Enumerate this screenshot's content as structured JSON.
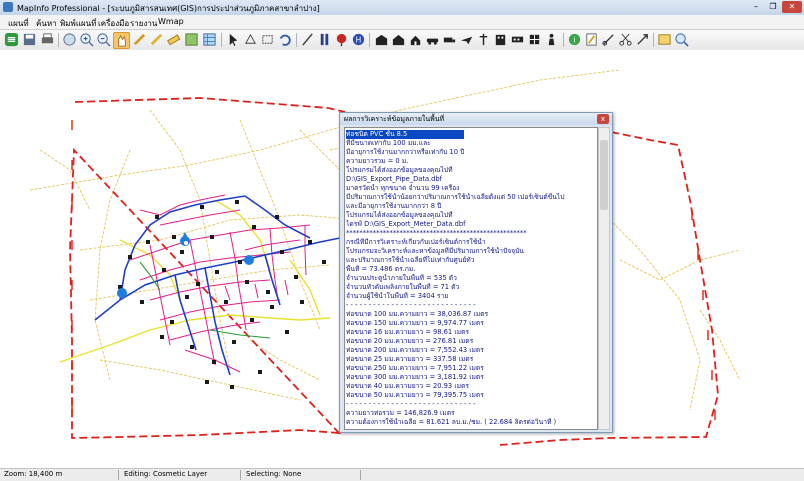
{
  "window": {
    "title": "MapInfo Professional - [ระบบภูมิสารสนเทศ(GIS)การประปาส่วนภูมิภาคสาขาลำปาง]",
    "minimize_label": "–",
    "restore_label": "❐",
    "close_label": "✕"
  },
  "menu": {
    "items": [
      "แผนที่",
      "ค้นหา",
      "พิมพ์แผนที่",
      "เครื่องมือ",
      "รายงาน",
      "Wmap"
    ]
  },
  "toolbar": {
    "icons": [
      "layers-icon",
      "save-icon",
      "print-icon",
      "zoom-extent-icon",
      "zoom-in-icon",
      "zoom-out-icon",
      "pan-icon",
      "select-icon",
      "measure-icon",
      "ruler-icon",
      "cosmetic-icon",
      "pointer-icon",
      "polygon-select-icon",
      "region-icon",
      "undo-icon",
      "pipe-tool-icon",
      "valve-tool-icon",
      "meter-icon",
      "hydrant-icon",
      "building-icon",
      "house-icon",
      "car-icon",
      "truck-icon",
      "plane-icon",
      "signpost-icon",
      "office-icon",
      "table-icon",
      "parcel-icon",
      "person-icon",
      "info-icon",
      "edit-icon",
      "tools-icon",
      "scissors-icon",
      "settings-icon",
      "report-icon",
      "search-icon"
    ]
  },
  "info_window": {
    "title": "ผลการวิเคราะห์ข้อมูลภายในพื้นที่",
    "close_label": "x",
    "lines": [
      "ท่อชนิด PVC ชั้น 8.5",
      "ที่มีขนาดเท่ากับ 100 มม.และ",
      "มีอายุการใช้งานมากกว่าหรือเท่ากับ 10 ปี",
      "ความยาวรวม = 0 ม.",
      "โปรแกรมได้ส่งออกข้อมูลของคุณไปที่",
      "D:\\GIS_Export_Pipe_Data.dbf",
      "มาตรวัดน้ำ ทุกขนาด จำนวน 99 เครื่อง",
      "มีปริมาณการใช้น้ำน้อยกว่าปริมาณการใช้น้ำเฉลี่ยตั้งแต่ 50 เปอร์เซ็นต์ขึ้นไป",
      "และมีอายุการใช้งานมากกว่า 8 ปี",
      "โปรแกรมได้ส่งออกข้อมูลของคุณไปที่",
      "ไดรฟ์ D:\\GIS_Export_Meter_Data.dbf",
      "******************************************************",
      "กรณีที่มีการวิเคราะห์เกี่ยวกับเปอร์เซ็นต์การใช้น้ำ",
      "โปรแกรมจะวิเคราะห์และหาข้อมูลที่มีปริมาณการใช้น้ำปัจจุบัน",
      "และปริมาณการใช้น้ำเฉลี่ยที่ไม่เท่ากับศูนย์ทั่ว",
      "พื้นที่ = 73.486 ตร.กม.",
      "จำนวนประตูน้ำภายในพื้นที่ = 535 ตัว",
      "จำนวนหัวดับเพลิงภายในพื้นที่ = 71 ตัว",
      "จำนวนผู้ใช้น้ำในพื้นที่ = 3404 ราย",
      "- - - - - - - - - - - - - - - - - - - - - - - - - - - - -",
      "ท่อขนาด 100 มม.ความยาว = 38,036.87 เมตร",
      "ท่อขนาด 150 มม.ความยาว = 9,974.77 เมตร",
      "ท่อขนาด 16 มม.ความยาว = 98.61 เมตร",
      "ท่อขนาด 20 มม.ความยาว = 276.81 เมตร",
      "ท่อขนาด 200 มม.ความยาว = 7,552.43 เมตร",
      "ท่อขนาด 25 มม.ความยาว = 337.58 เมตร",
      "ท่อขนาด 250 มม.ความยาว = 7,951.22 เมตร",
      "ท่อขนาด 300 มม.ความยาว = 3,181.92 เมตร",
      "ท่อขนาด 40 มม.ความยาว = 20.93 เมตร",
      "ท่อขนาด 50 มม.ความยาว = 79,395.75 เมตร",
      "- - - - - - - - - - - - - - - - - - - - - - - - - - - - -",
      "ความยาวท่อรวม = 146,826.9 เมตร",
      "ความต้องการใช้น้ำเฉลี่ย  = 81.621 ลบ.ม./ชม. ( 22.684 ลิตรต่อวินาที )"
    ]
  },
  "status": {
    "zoom": "Zoom: 18,400 m",
    "editing": "Editing: Cosmetic Layer",
    "selecting": "Selecting: None"
  },
  "colors": {
    "boundary": "#e0201a",
    "roads": "#e3c65c",
    "main_pipe": "#1f3fc9",
    "distribution_pipe": "#e0208a",
    "secondary_pipe": "#ece030",
    "water_source": "#1f7de0",
    "info_text": "#12198a",
    "selection": "#0b48c4"
  }
}
